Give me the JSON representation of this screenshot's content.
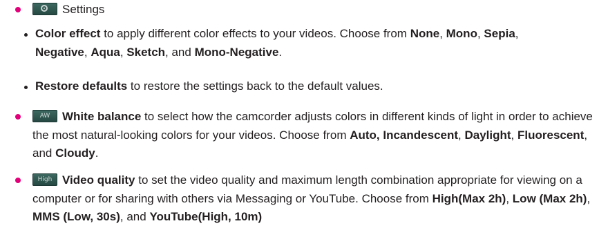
{
  "settings": {
    "icon": "gear-icon",
    "label": "Settings",
    "sub_items": [
      {
        "term": "Color effect",
        "text1": " to apply different color effects to your videos. Choose from ",
        "options": [
          "None",
          "Mono",
          "Sepia",
          "Negative",
          "Aqua",
          "Sketch",
          "Mono-Negative"
        ],
        "sep_comma": ", ",
        "sep_and": ", and ",
        "end": "."
      },
      {
        "term": "Restore defaults",
        "text1": " to restore the settings back to the default values."
      }
    ]
  },
  "white_balance": {
    "icon": "white-balance-icon",
    "icon_text": "AW",
    "term": "White balance",
    "text1": " to select how the camcorder adjusts colors in different kinds of light in order to achieve the most natural-looking colors for your videos. Choose from ",
    "opt1": "Auto, Incandescent",
    "sep1": ", ",
    "opt2": "Daylight",
    "sep2": ", ",
    "opt3": "Fluorescent",
    "sep3": ", and ",
    "opt4": "Cloudy",
    "end": "."
  },
  "video_quality": {
    "icon": "video-quality-icon",
    "icon_text": "High",
    "term": "Video quality",
    "text1": " to set the video quality and maximum length combination appropriate for viewing on a computer or for sharing with others via Messaging or YouTube. Choose from ",
    "opt1": "High(Max 2h)",
    "sep1": ", ",
    "opt2": "Low (Max 2h)",
    "sep2": ", ",
    "opt3": "MMS (Low, 30s)",
    "sep3": ", and ",
    "opt4": "YouTube(High, 10m)"
  },
  "colors": {
    "bullet_accent": "#e2007a",
    "text": "#231f20",
    "icon_bg": "#2f5852"
  }
}
